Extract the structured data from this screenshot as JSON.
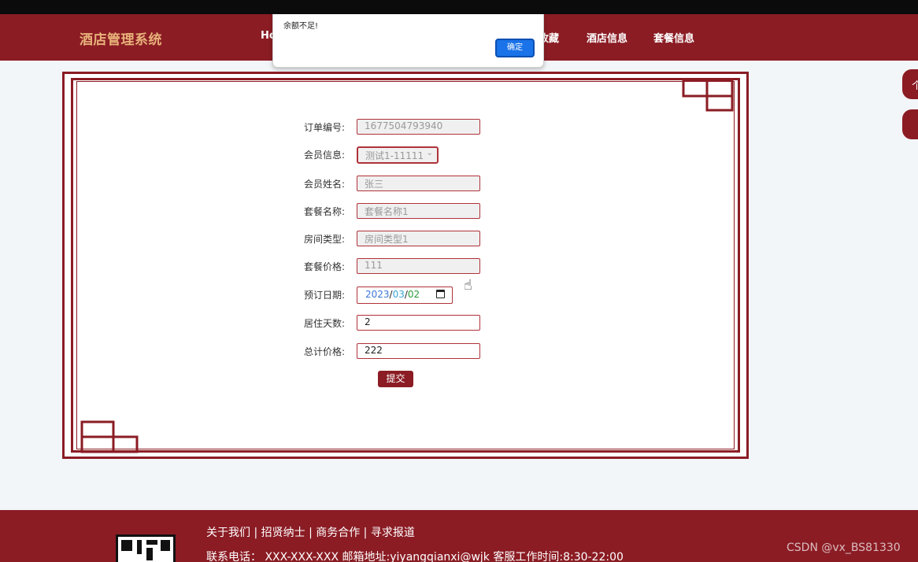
{
  "header": {
    "brand": "酒店管理系统",
    "nav": [
      {
        "label": "Ho"
      },
      {
        "label": "收藏"
      },
      {
        "label": "酒店信息"
      },
      {
        "label": "套餐信息"
      }
    ]
  },
  "alert": {
    "message": "余额不足!",
    "ok_label": "确定"
  },
  "form": {
    "fields": [
      {
        "label": "订单编号:",
        "value": "1677504793940"
      },
      {
        "label": "会员信息:",
        "value": "测试1-11111"
      },
      {
        "label": "会员姓名:",
        "value": "张三"
      },
      {
        "label": "套餐名称:",
        "value": "套餐名称1"
      },
      {
        "label": "房间类型:",
        "value": "房间类型1"
      },
      {
        "label": "套餐价格:",
        "value": "111"
      },
      {
        "label": "预订日期:",
        "value_year": "2023",
        "value_month": "03",
        "value_day": "02",
        "separator": "/"
      },
      {
        "label": "居住天数:",
        "value": "2"
      },
      {
        "label": "总计价格:",
        "value": "222"
      }
    ],
    "submit_label": "提交"
  },
  "right_tabs": [
    {
      "label": "个"
    },
    {
      "label": ""
    }
  ],
  "footer": {
    "links": "关于我们 | 招贤纳士 | 商务合作 | 寻求报道",
    "contact": "联系电话： XXX-XXX-XXX 邮箱地址:yiyangqianxi@wjk 客服工作时间:8:30-22:00"
  },
  "watermark": "CSDN @vx_BS81330",
  "colors": {
    "primary": "#8b1c24",
    "brand_text": "#e8b27a",
    "alert_button": "#1a73e8"
  }
}
